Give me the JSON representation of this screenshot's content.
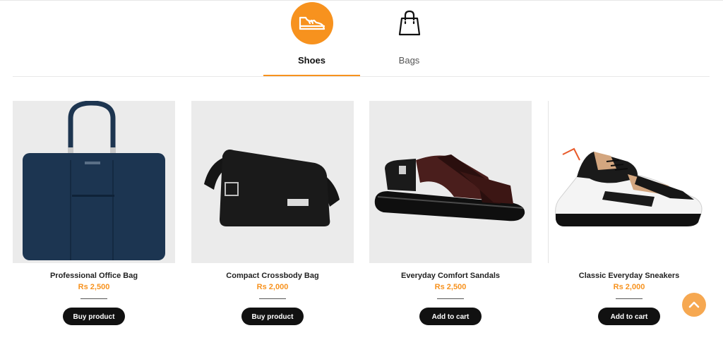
{
  "tabs": [
    {
      "label": "Shoes",
      "icon": "sneaker-icon",
      "active": true
    },
    {
      "label": "Bags",
      "icon": "handbag-icon",
      "active": false
    }
  ],
  "products": [
    {
      "name": "Professional Office Bag",
      "price": "Rs 2,500",
      "button": "Buy product",
      "image": "navy-briefcase-bag"
    },
    {
      "name": "Compact Crossbody Bag",
      "price": "Rs 2,000",
      "button": "Buy product",
      "image": "black-crossbody-bag"
    },
    {
      "name": "Everyday Comfort Sandals",
      "price": "Rs 2,500",
      "button": "Add to cart",
      "image": "brown-strap-sandal"
    },
    {
      "name": "Classic Everyday Sneakers",
      "price": "Rs 2,000",
      "button": "Add to cart",
      "image": "white-chunky-sneaker"
    }
  ],
  "colors": {
    "accent": "#f7921e",
    "button": "#111111",
    "scroll_top": "#f6a851"
  }
}
